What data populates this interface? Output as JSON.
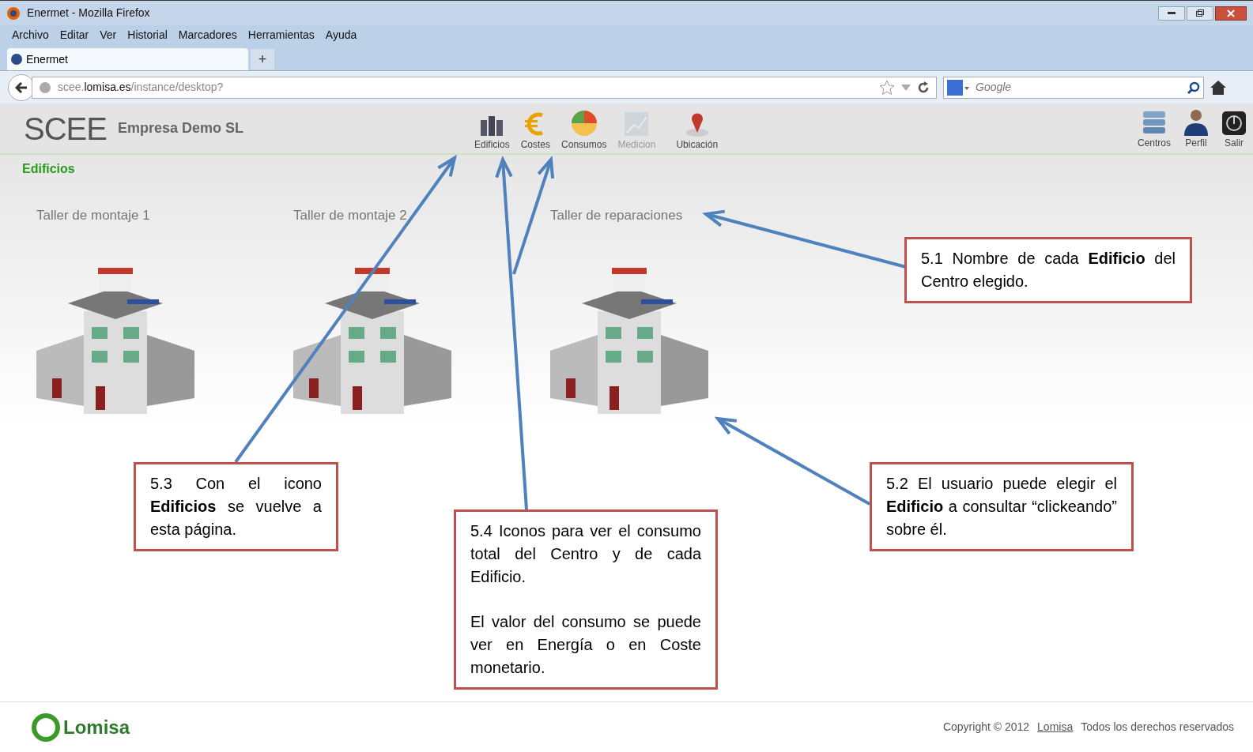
{
  "window": {
    "title": "Enermet - Mozilla Firefox"
  },
  "menu": [
    "Archivo",
    "Editar",
    "Ver",
    "Historial",
    "Marcadores",
    "Herramientas",
    "Ayuda"
  ],
  "tabs": [
    {
      "label": "Enermet",
      "selected": true
    }
  ],
  "new_tab": "+",
  "address": "scee.**lomisa.es**/instance/desktop?",
  "search": {
    "placeholder": "Google"
  },
  "app": {
    "logo": "SCEE",
    "company": "Empresa Demo SL",
    "toolbar": [
      {
        "label": "Edificios",
        "kind": "buildings",
        "disabled": false
      },
      {
        "label": "Costes",
        "kind": "euro",
        "disabled": false
      },
      {
        "label": "Consumos",
        "kind": "pie",
        "disabled": false
      },
      {
        "label": "Medicion",
        "kind": "chart",
        "disabled": true
      },
      {
        "label": "Ubicación",
        "kind": "pin",
        "disabled": false
      }
    ],
    "right_toolbar": [
      {
        "label": "Centros",
        "kind": "server"
      },
      {
        "label": "Perfil",
        "kind": "person"
      },
      {
        "label": "Salir",
        "kind": "power"
      }
    ],
    "section_title": "Edificios",
    "buildings": [
      {
        "name": "Taller de montaje 1"
      },
      {
        "name": "Taller de montaje 2"
      },
      {
        "name": "Taller de reparaciones"
      }
    ]
  },
  "callouts": [
    {
      "paragraphs": [
        "5.1 Nombre de cada **Edificio** del Centro elegido."
      ]
    },
    {
      "paragraphs": [
        "5.3 Con el icono **Edificios** se vuelve a esta página."
      ]
    },
    {
      "paragraphs": [
        "5.4 Iconos para ver el consumo total del Centro y de cada Edificio.",
        "El valor del consumo se puede ver en Energía o en Coste monetario."
      ]
    },
    {
      "paragraphs": [
        "5.2 El usuario puede elegir el **Edificio** a consultar “clickeando” sobre él."
      ]
    }
  ],
  "footer": {
    "logo": "Lomisa",
    "copyright": "Copyright © 2012",
    "link": "Lomisa",
    "rights": "Todos los derechos reservados"
  }
}
